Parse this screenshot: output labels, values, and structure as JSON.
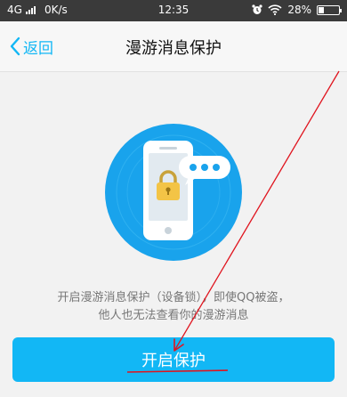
{
  "status_bar": {
    "network": "4G",
    "speed": "0K/s",
    "time": "12:35",
    "battery": "28%",
    "battery_level": 0.28
  },
  "nav": {
    "back_label": "返回",
    "title": "漫游消息保护"
  },
  "main": {
    "description_line1": "开启漫游消息保护（设备锁），即使QQ被盗，",
    "description_line2": "他人也无法查看你的漫游消息",
    "primary_button_label": "开启保护"
  },
  "colors": {
    "accent": "#12b7f5",
    "annotation": "#e0141e"
  }
}
